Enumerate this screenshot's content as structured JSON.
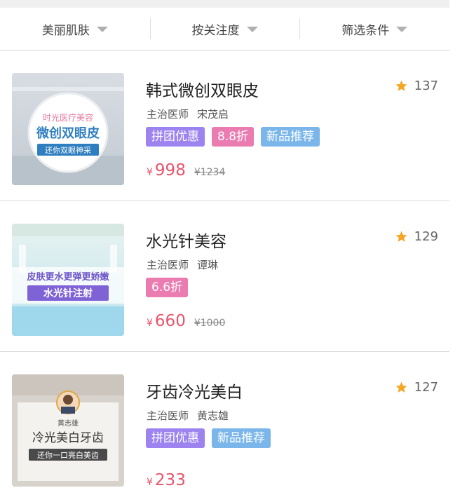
{
  "filters": [
    {
      "label": "美丽肌肤"
    },
    {
      "label": "按关注度"
    },
    {
      "label": "筛选条件"
    }
  ],
  "items": [
    {
      "title": "韩式微创双眼皮",
      "rating": "137",
      "doctor_label": "主治医师",
      "doctor_name": "宋茂启",
      "tags": [
        "拼团优惠",
        "8.8折",
        "新品推荐"
      ],
      "currency": "¥",
      "price": "998",
      "original_price": "¥1234",
      "thumb": {
        "line1": "时光医疗美容",
        "line2": "微创双眼皮",
        "line3": "还你双眼神采"
      }
    },
    {
      "title": "水光针美容",
      "rating": "129",
      "doctor_label": "主治医师",
      "doctor_name": "谭琳",
      "tags": [
        "6.6折"
      ],
      "currency": "¥",
      "price": "660",
      "original_price": "¥1000",
      "thumb": {
        "line1": "皮肤更水更弹更娇嫩",
        "line2": "水光针注射"
      }
    },
    {
      "title": "牙齿冷光美白",
      "rating": "127",
      "doctor_label": "主治医师",
      "doctor_name": "黄志雄",
      "tags": [
        "拼团优惠",
        "新品推荐"
      ],
      "currency": "¥",
      "price": "233",
      "thumb": {
        "line1": "黄志雄",
        "line2": "冷光美白牙齿",
        "line3": "还你一口亮白美齿"
      }
    }
  ],
  "colors": {
    "price": "#e8546b",
    "star": "#f5a623",
    "tag_purple": "#9c83f0",
    "tag_pink": "#ea7cb1",
    "tag_blue": "#7ab6ea"
  },
  "icons": {
    "rating": "star-icon",
    "filter_caret": "caret-down-icon"
  }
}
